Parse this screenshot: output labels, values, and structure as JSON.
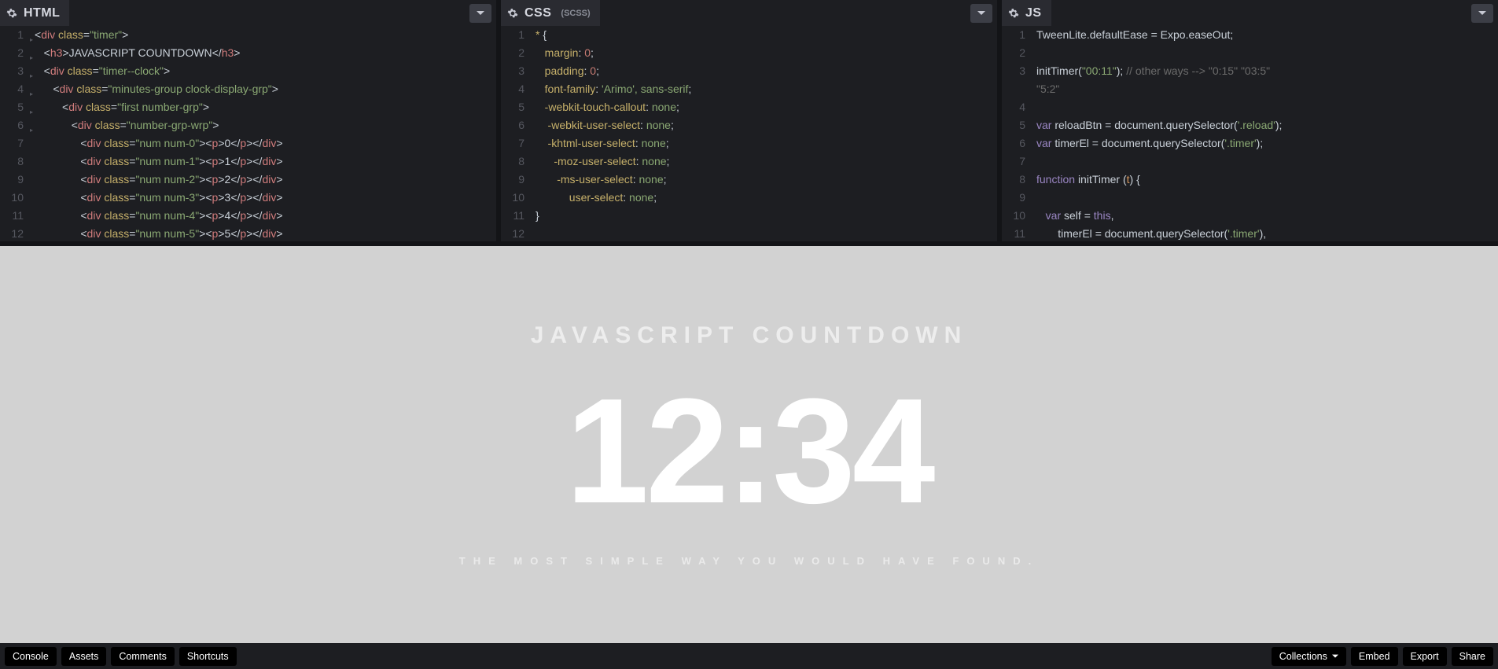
{
  "panes": {
    "html": {
      "title": "HTML",
      "sub": ""
    },
    "css": {
      "title": "CSS",
      "sub": "(SCSS)"
    },
    "js": {
      "title": "JS",
      "sub": ""
    }
  },
  "preview": {
    "title": "JAVASCRIPT COUNTDOWN",
    "clock": "12:34",
    "tagline": "THE MOST SIMPLE WAY YOU WOULD HAVE FOUND."
  },
  "bottom": {
    "console": "Console",
    "assets": "Assets",
    "comments": "Comments",
    "shortcuts": "Shortcuts",
    "collections": "Collections",
    "embed": "Embed",
    "export": "Export",
    "share": "Share"
  },
  "code": {
    "html": [
      {
        "n": 1,
        "fold": true,
        "ind": 0,
        "t": "html-open",
        "tag": "div",
        "attr": "class",
        "val": "timer"
      },
      {
        "n": 2,
        "fold": true,
        "ind": 1,
        "t": "html-full",
        "tag": "h3",
        "text": "JAVASCRIPT COUNTDOWN"
      },
      {
        "n": 3,
        "fold": true,
        "ind": 1,
        "t": "html-open",
        "tag": "div",
        "attr": "class",
        "val": "timer--clock"
      },
      {
        "n": 4,
        "fold": true,
        "ind": 2,
        "t": "html-open",
        "tag": "div",
        "attr": "class",
        "val": "minutes-group clock-display-grp"
      },
      {
        "n": 5,
        "fold": true,
        "ind": 3,
        "t": "html-open",
        "tag": "div",
        "attr": "class",
        "val": "first number-grp"
      },
      {
        "n": 6,
        "fold": true,
        "ind": 4,
        "t": "html-open",
        "tag": "div",
        "attr": "class",
        "val": "number-grp-wrp"
      },
      {
        "n": 7,
        "fold": false,
        "ind": 5,
        "t": "html-num",
        "val": "num num-0",
        "d": "0"
      },
      {
        "n": 8,
        "fold": false,
        "ind": 5,
        "t": "html-num",
        "val": "num num-1",
        "d": "1"
      },
      {
        "n": 9,
        "fold": false,
        "ind": 5,
        "t": "html-num",
        "val": "num num-2",
        "d": "2"
      },
      {
        "n": 10,
        "fold": false,
        "ind": 5,
        "t": "html-num",
        "val": "num num-3",
        "d": "3"
      },
      {
        "n": 11,
        "fold": false,
        "ind": 5,
        "t": "html-num",
        "val": "num num-4",
        "d": "4"
      },
      {
        "n": 12,
        "fold": false,
        "ind": 5,
        "t": "html-num",
        "val": "num num-5",
        "d": "5"
      }
    ],
    "css": [
      {
        "n": 1,
        "t": "css-sel",
        "text": "* {"
      },
      {
        "n": 2,
        "t": "css-decl",
        "prop": "margin",
        "val": "0",
        "num": true
      },
      {
        "n": 3,
        "t": "css-decl",
        "prop": "padding",
        "val": "0",
        "num": true
      },
      {
        "n": 4,
        "t": "css-decl",
        "prop": "font-family",
        "val": "'Arimo', sans-serif",
        "num": false
      },
      {
        "n": 5,
        "t": "css-decl",
        "prop": "-webkit-touch-callout",
        "val": "none",
        "num": false
      },
      {
        "n": 6,
        "t": "css-decl",
        "prop": " -webkit-user-select",
        "val": "none",
        "num": false
      },
      {
        "n": 7,
        "t": "css-decl",
        "prop": " -khtml-user-select",
        "val": "none",
        "num": false
      },
      {
        "n": 8,
        "t": "css-decl",
        "prop": "   -moz-user-select",
        "val": "none",
        "num": false
      },
      {
        "n": 9,
        "t": "css-decl",
        "prop": "    -ms-user-select",
        "val": "none",
        "num": false
      },
      {
        "n": 10,
        "t": "css-decl",
        "prop": "        user-select",
        "val": "none",
        "num": false
      },
      {
        "n": 11,
        "t": "css-close"
      },
      {
        "n": 12,
        "t": "css-blank"
      }
    ],
    "js": [
      {
        "n": 1,
        "t": "js",
        "html": "<span class='obj'>TweenLite</span><span class='punct'>.</span><span class='obj'>defaultEase</span> <span class='punct'>=</span> <span class='obj'>Expo</span><span class='punct'>.</span><span class='obj'>easeOut</span><span class='punct'>;</span>"
      },
      {
        "n": 2,
        "t": "js",
        "html": ""
      },
      {
        "n": 3,
        "t": "js",
        "html": "<span class='fnname'>initTimer</span><span class='punct'>(</span><span class='str'>\"00:11\"</span><span class='punct'>);</span> <span class='comment'>// other ways --&gt; \"0:15\" \"03:5\" </span>"
      },
      {
        "n": "",
        "t": "js-wrap",
        "html": "<span class='comment'>\"5:2\"</span>"
      },
      {
        "n": 4,
        "t": "js",
        "html": ""
      },
      {
        "n": 5,
        "t": "js",
        "html": "<span class='kw'>var</span> <span class='obj'>reloadBtn</span> <span class='punct'>=</span> <span class='obj'>document</span><span class='punct'>.</span><span class='fnname'>querySelector</span><span class='punct'>(</span><span class='str'>'.reload'</span><span class='punct'>);</span>"
      },
      {
        "n": 6,
        "t": "js",
        "html": "<span class='kw'>var</span> <span class='obj'>timerEl</span> <span class='punct'>=</span> <span class='obj'>document</span><span class='punct'>.</span><span class='fnname'>querySelector</span><span class='punct'>(</span><span class='str'>'.timer'</span><span class='punct'>);</span>"
      },
      {
        "n": 7,
        "t": "js",
        "html": ""
      },
      {
        "n": 8,
        "t": "js",
        "html": "<span class='kw'>function</span> <span class='fnname'>initTimer</span> <span class='punct'>(</span><span class='param'>t</span><span class='punct'>) {</span>"
      },
      {
        "n": 9,
        "t": "js",
        "html": ""
      },
      {
        "n": 10,
        "t": "js",
        "html": "   <span class='kw'>var</span> <span class='obj'>self</span> <span class='punct'>=</span> <span class='kw'>this</span><span class='punct'>,</span>"
      },
      {
        "n": 11,
        "t": "js",
        "html": "       <span class='obj'>timerEl</span> <span class='punct'>=</span> <span class='obj'>document</span><span class='punct'>.</span><span class='fnname'>querySelector</span><span class='punct'>(</span><span class='str'>'.timer'</span><span class='punct'>),</span>"
      }
    ]
  }
}
